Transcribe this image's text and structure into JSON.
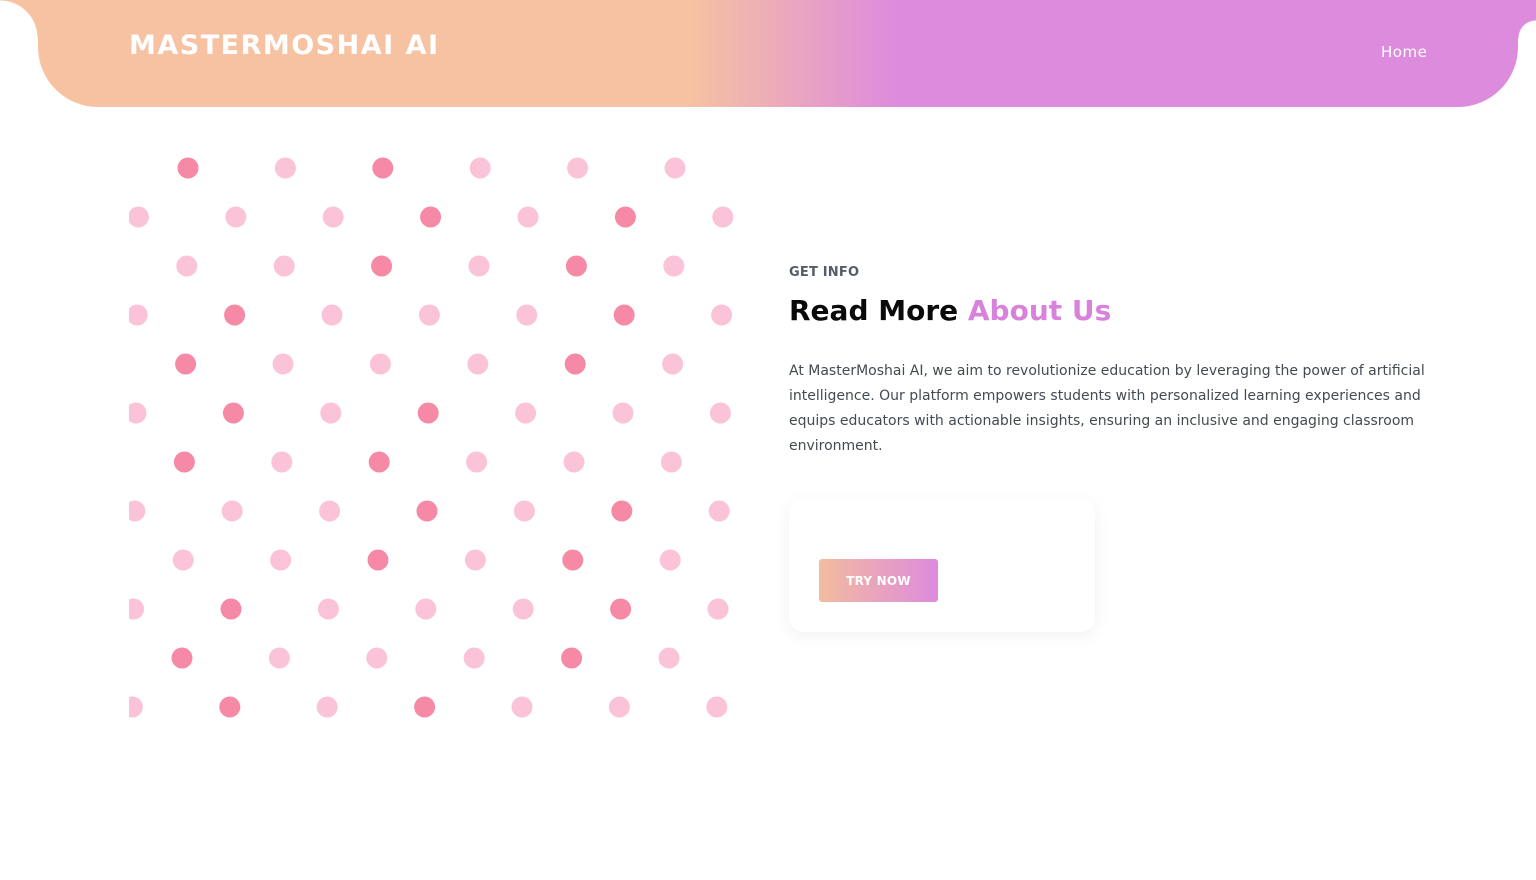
{
  "header": {
    "brand": "MASTERMOSHAI AI",
    "nav": {
      "home": "Home"
    }
  },
  "about": {
    "kicker": "GET INFO",
    "title_plain": "Read More ",
    "title_accent": "About Us",
    "description": "At MasterMoshai AI, we aim to revolutionize education by leveraging the power of artificial intelligence. Our platform empowers students with personalized learning experiences and equips educators with actionable insights, ensuring an inclusive and engaging classroom environment."
  },
  "cta": {
    "button_label": "TRY NOW"
  },
  "colors": {
    "peach": "#f6c2a1",
    "orchid": "#dd8bdd",
    "dot_dark": "#f68aa6",
    "dot_light": "#fbc3d8"
  },
  "icons": {
    "pattern": "dots-pattern"
  }
}
